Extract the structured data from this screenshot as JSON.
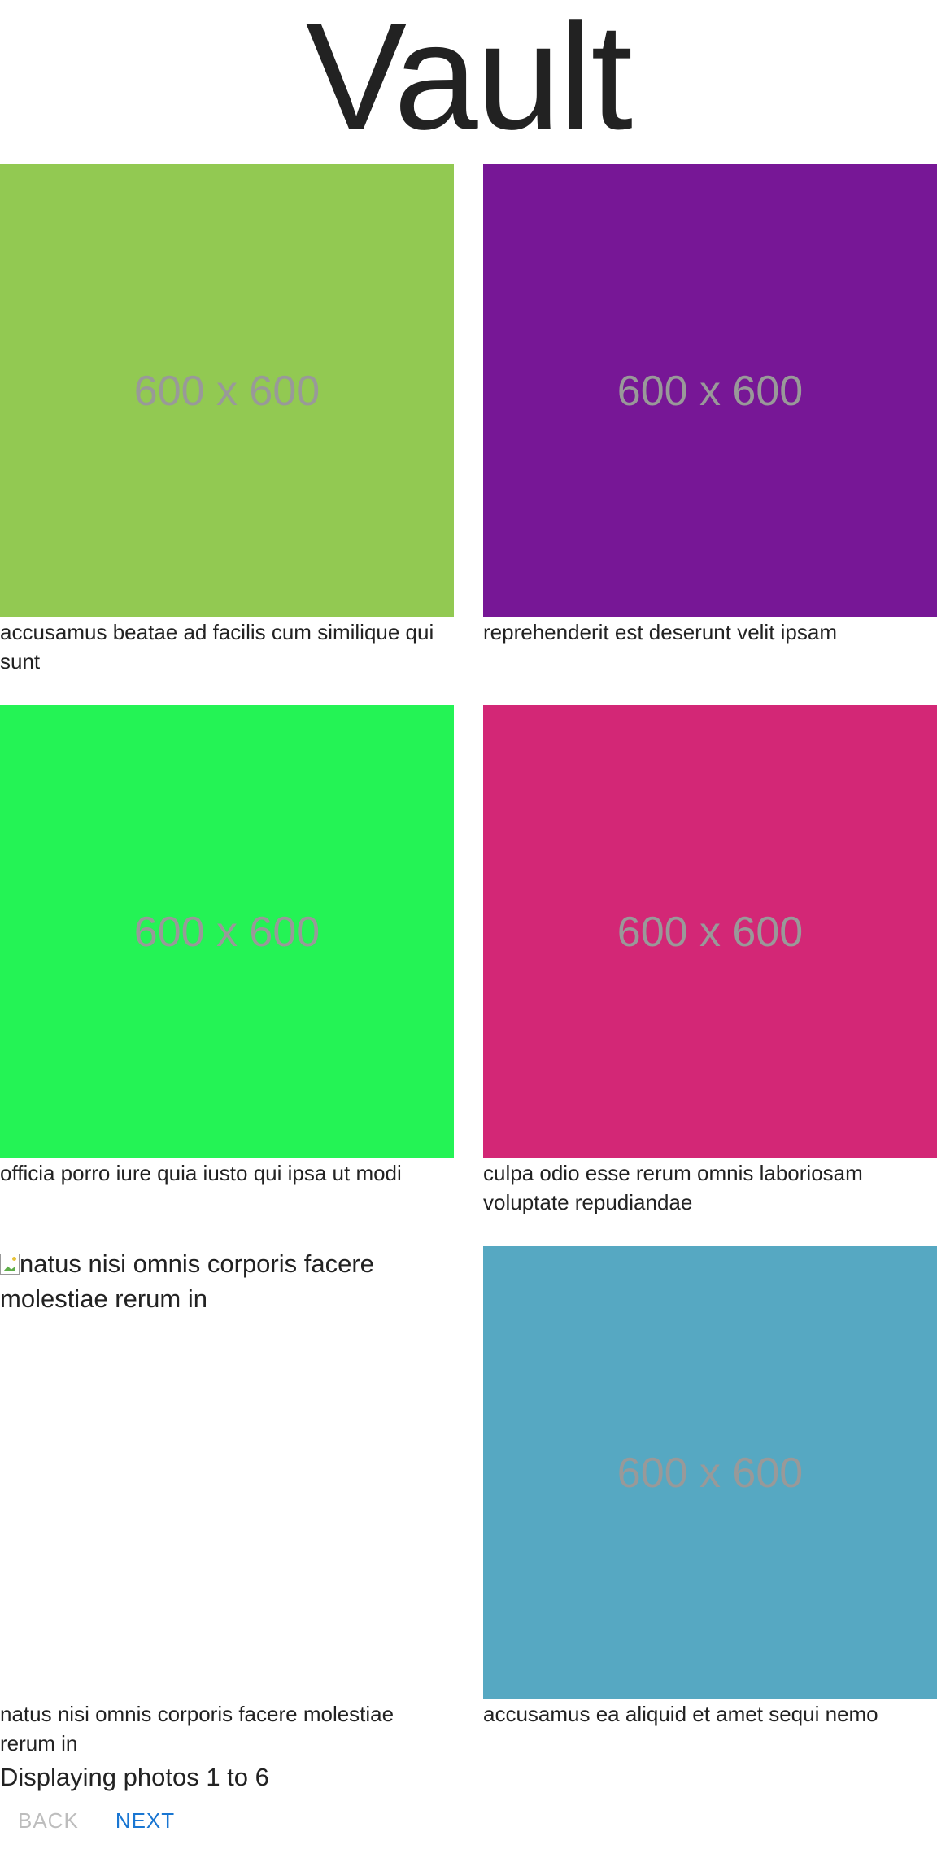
{
  "header": {
    "title": "Vault"
  },
  "photos": [
    {
      "label": "600 x 600",
      "caption": "accusamus beatae ad facilis cum similique qui sunt",
      "color": "#92c952",
      "broken": false
    },
    {
      "label": "600 x 600",
      "caption": "reprehenderit est deserunt velit ipsam",
      "color": "#771796",
      "broken": false
    },
    {
      "label": "600 x 600",
      "caption": "officia porro iure quia iusto qui ipsa ut modi",
      "color": "#24f355",
      "broken": false
    },
    {
      "label": "600 x 600",
      "caption": "culpa odio esse rerum omnis laboriosam voluptate repudiandae",
      "color": "#d32776",
      "broken": false
    },
    {
      "label": "",
      "alt": "natus nisi omnis corporis facere molestiae rerum in",
      "caption": "natus nisi omnis corporis facere molestiae rerum in",
      "broken": true
    },
    {
      "label": "600 x 600",
      "caption": "accusamus ea aliquid et amet sequi nemo",
      "color": "#56a8c2",
      "broken": false
    }
  ],
  "footer": {
    "status": "Displaying photos 1 to 6",
    "back_label": "BACK",
    "next_label": "NEXT"
  },
  "colors": {
    "accent": "#1976d2",
    "disabled": "#bdbdbd",
    "placeholder_text": "#999999"
  }
}
